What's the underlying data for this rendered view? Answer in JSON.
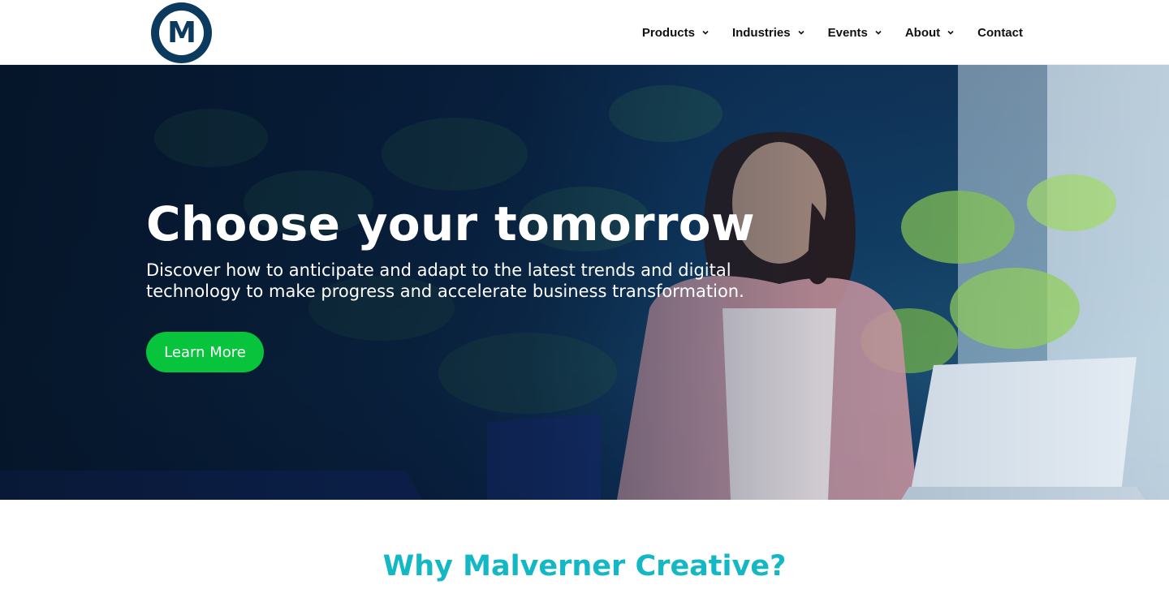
{
  "brand": {
    "logo_letter": "M"
  },
  "nav": {
    "items": [
      {
        "label": "Products",
        "has_dropdown": true
      },
      {
        "label": "Industries",
        "has_dropdown": true
      },
      {
        "label": "Events",
        "has_dropdown": true
      },
      {
        "label": "About",
        "has_dropdown": true
      },
      {
        "label": "Contact",
        "has_dropdown": false
      }
    ]
  },
  "hero": {
    "title": "Choose your tomorrow",
    "subtitle": "Discover how to anticipate and adapt to the latest trends and digital technology to make progress and accelerate business transformation.",
    "cta_label": "Learn More"
  },
  "section": {
    "title": "Why Malverner Creative?"
  },
  "colors": {
    "brand_navy": "#0c3a5e",
    "cta_green": "#07c43c",
    "heading_teal": "#14b8c4"
  }
}
